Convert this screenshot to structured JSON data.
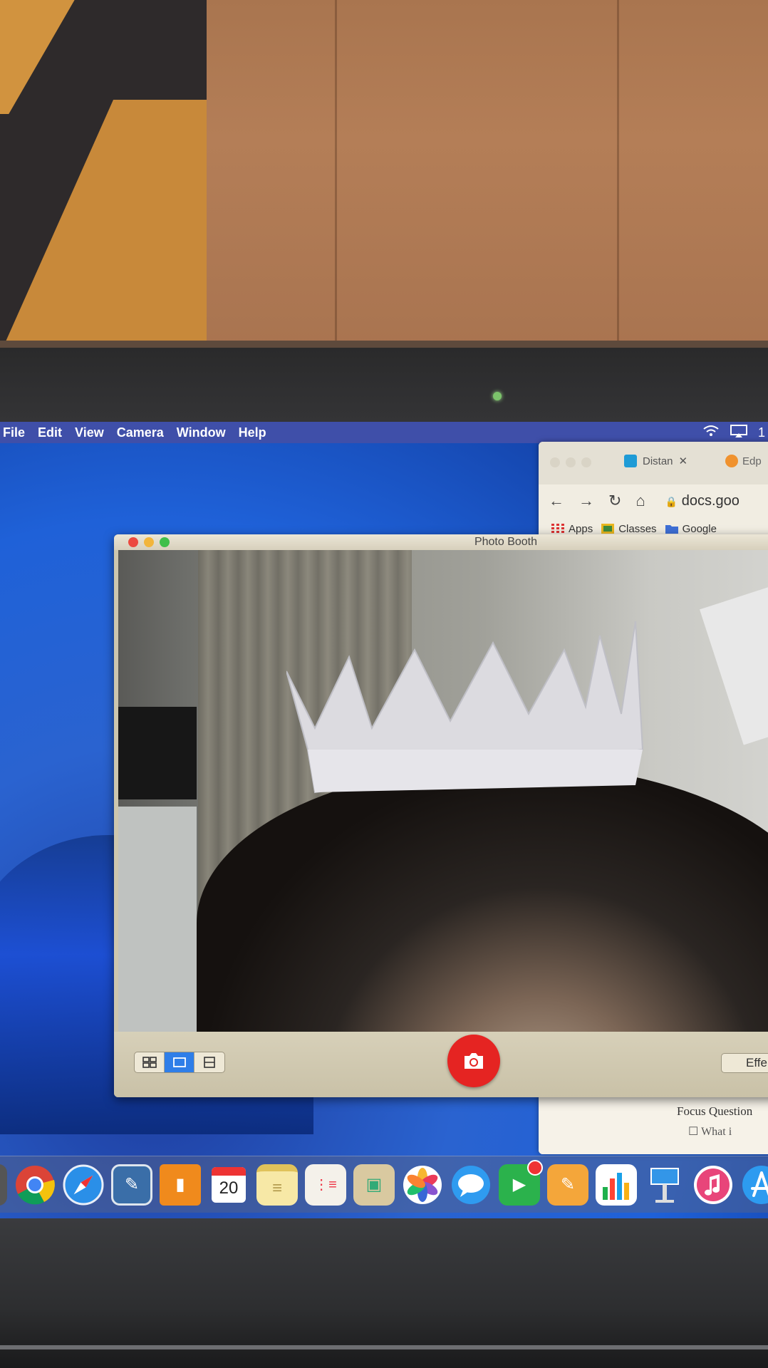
{
  "menubar": {
    "items": [
      "File",
      "Edit",
      "View",
      "Camera",
      "Window",
      "Help"
    ],
    "status_icons": [
      "wifi-icon",
      "airplay-icon"
    ],
    "status_text": "1"
  },
  "chrome": {
    "tab1_label": "Distan",
    "tab1_close": "✕",
    "tab2_label": "Edp",
    "omnibox": "docs.goo",
    "bookmarks": [
      "Apps",
      "Classes",
      "Google"
    ],
    "doc_heading": "Focus Question",
    "doc_line": "What i"
  },
  "photobooth": {
    "title": "Photo Booth",
    "effects_label": "Effe",
    "view_modes": [
      "grid-view",
      "single-view",
      "strip-view"
    ],
    "active_view": "single-view"
  },
  "dock": {
    "apps": [
      "chrome-app",
      "safari-app",
      "preview-app",
      "books-app",
      "calendar-app",
      "notes-app",
      "reminders-app",
      "photo-app",
      "photos-app",
      "messages-app",
      "facetime-app",
      "pages-app",
      "numbers-app",
      "keynote-app",
      "itunes-app",
      "app-store-app"
    ],
    "calendar_day": "20"
  },
  "colors": {
    "menubar": "#3f4fa9",
    "shutter": "#e52422",
    "active_view": "#2f7ee8",
    "desktop": "#1f61d8"
  }
}
